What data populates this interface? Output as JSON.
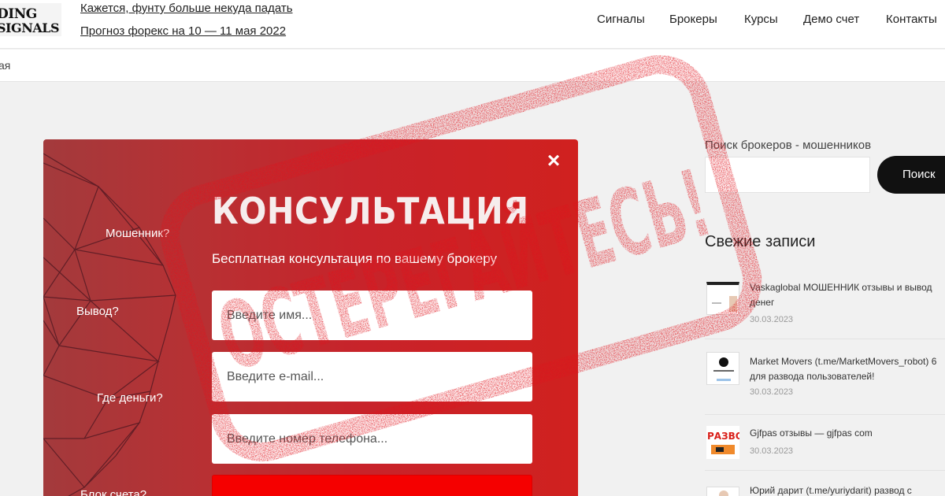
{
  "header": {
    "logo_line1": "DING",
    "logo_line2": "SIGNALS",
    "link1": "Кажется, фунту больше некуда падать",
    "link2": "Прогноз форекс на 10 — 11 мая 2022",
    "nav": [
      "Сигналы",
      "Брокеры",
      "Курсы",
      "Демо счет",
      "Контакты"
    ]
  },
  "breadcrumb": "ая",
  "popup": {
    "title": "КОНСУЛЬТАЦИЯ",
    "subtitle": "Бесплатная консультация по вашему брокеру",
    "questions": [
      "Мошенник?",
      "Вывод?",
      "Где деньги?",
      "Блок счета?"
    ],
    "name_placeholder": "Введите имя...",
    "email_placeholder": "Введите e-mail...",
    "phone_placeholder": "Введите номер телефона...",
    "close_label": "×"
  },
  "stamp": {
    "text": "ОСТЕРЕГАЙТЕСЬ!",
    "color": "#e0131b"
  },
  "sidebar": {
    "search_label": "Поиск брокеров - мошенников",
    "search_button": "Поиск",
    "recent_heading": "Свежие записи",
    "posts": [
      {
        "title": "Vaskaglobal МОШЕННИК отзывы и вывод денег",
        "date": "30.03.2023"
      },
      {
        "title": "Market Movers (t.me/MarketMovers_robot) 6 для развода пользователей!",
        "date": "30.03.2023"
      },
      {
        "title": "Gjfpas отзывы — gjfpas com",
        "date": "30.03.2023"
      },
      {
        "title": "Юрий дарит (t.me/yuriydarit) развод с",
        "date": ""
      }
    ],
    "thumb3_text": "РАЗВОД"
  }
}
